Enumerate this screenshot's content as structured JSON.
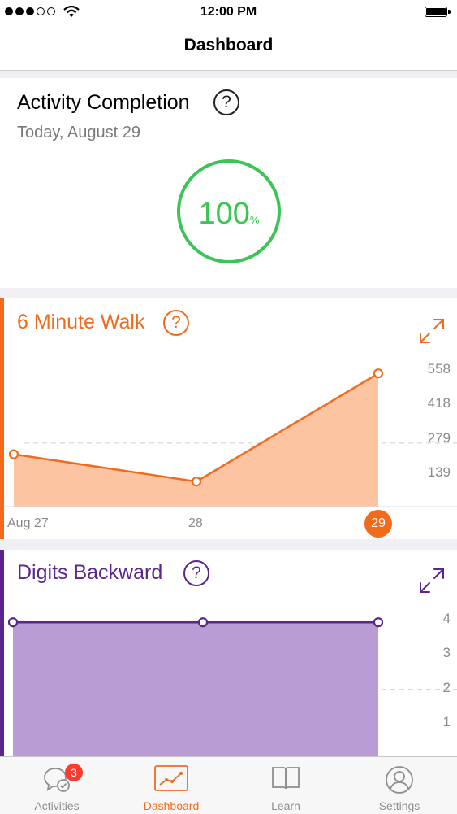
{
  "status_bar": {
    "time": "12:00 PM",
    "signal_strength": 3,
    "signal_max": 5
  },
  "nav": {
    "title": "Dashboard"
  },
  "activity_completion": {
    "title": "Activity Completion",
    "help": "?",
    "date": "Today, August 29",
    "percent": "100",
    "percent_unit": "%",
    "ring_color": "#3cc457"
  },
  "six_minute_walk": {
    "title": "6 Minute Walk",
    "help": "?",
    "color": "#f26b1d",
    "fill": "#fdc4a1",
    "y_ticks": [
      "558",
      "418",
      "279",
      "139"
    ],
    "x_ticks": [
      "Aug 27",
      "28",
      "29"
    ],
    "selected_x": "29"
  },
  "digits_backward": {
    "title": "Digits Backward",
    "help": "?",
    "color": "#5b2590",
    "fill": "#b99cd3",
    "y_ticks": [
      "4",
      "3",
      "2",
      "1"
    ]
  },
  "chart_data": [
    {
      "type": "area",
      "title": "6 Minute Walk",
      "categories": [
        "Aug 27",
        "28",
        "29"
      ],
      "values": [
        230,
        110,
        585
      ],
      "ylim": [
        0,
        700
      ],
      "yticks": [
        139,
        279,
        418,
        558
      ],
      "grid": "dashed line at 279"
    },
    {
      "type": "area",
      "title": "Digits Backward",
      "categories": [
        "Aug 27",
        "28",
        "29"
      ],
      "values": [
        4,
        4,
        4
      ],
      "ylim": [
        0,
        4.2
      ],
      "yticks": [
        1,
        2,
        3,
        4
      ],
      "grid": "dashed line at 2"
    }
  ],
  "tabs": [
    {
      "label": "Activities",
      "icon": "chat-check-icon",
      "badge": "3"
    },
    {
      "label": "Dashboard",
      "icon": "chart-icon",
      "active": true
    },
    {
      "label": "Learn",
      "icon": "book-icon"
    },
    {
      "label": "Settings",
      "icon": "person-icon"
    }
  ]
}
